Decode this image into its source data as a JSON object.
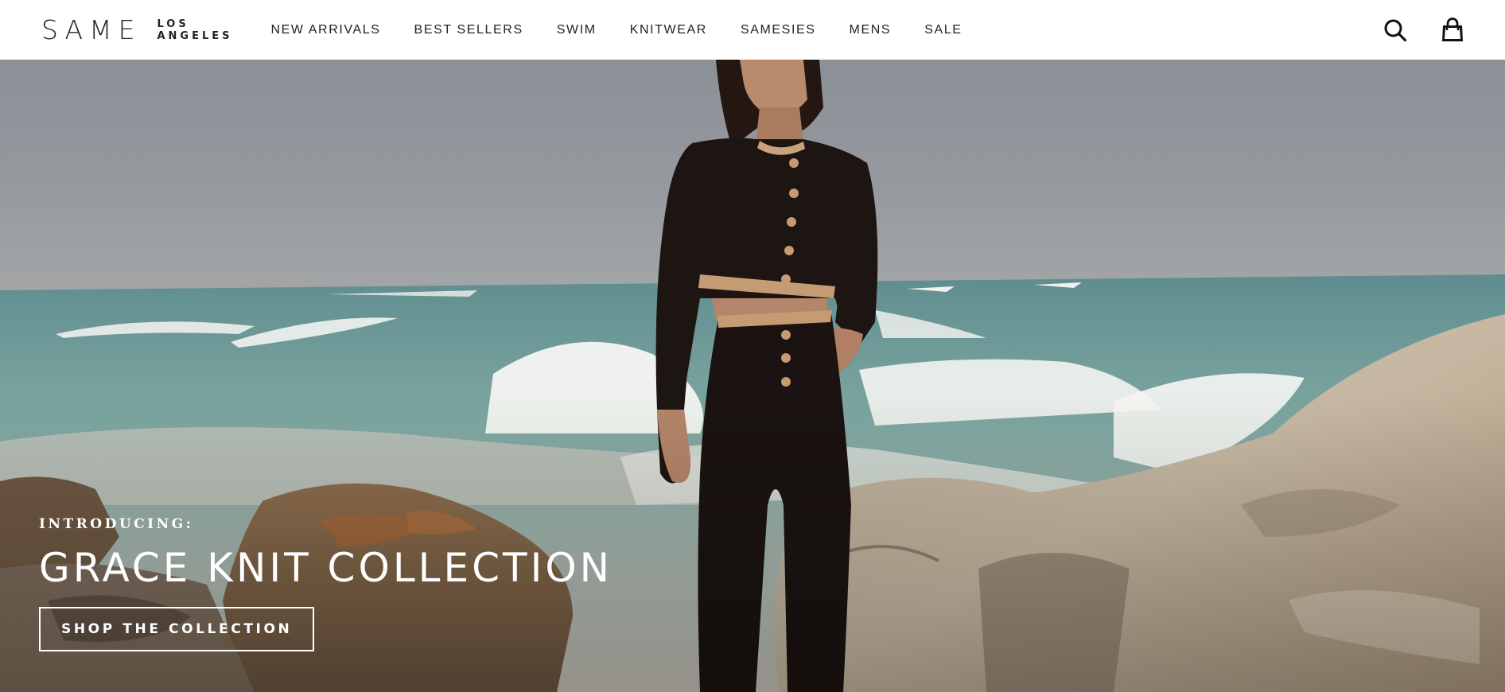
{
  "header": {
    "logo": {
      "wordmark": "SAME",
      "sub_line_1": "LOS",
      "sub_line_2": "ANGELES"
    },
    "nav": [
      {
        "label": "NEW ARRIVALS"
      },
      {
        "label": "BEST SELLERS"
      },
      {
        "label": "SWIM"
      },
      {
        "label": "KNITWEAR"
      },
      {
        "label": "SAMESIES"
      },
      {
        "label": "MENS"
      },
      {
        "label": "SALE"
      }
    ],
    "icons": {
      "search": "search-icon",
      "cart": "cart-icon"
    }
  },
  "hero": {
    "kicker": "INTRODUCING:",
    "title": "GRACE KNIT COLLECTION",
    "cta_label": "SHOP THE COLLECTION"
  },
  "colors": {
    "header_bg": "#ffffff",
    "text_dark": "#222222",
    "hero_text": "#ffffff",
    "sky": "#8e9298",
    "sea": "#6f9b99",
    "rock": "#b6a893",
    "outfit": "#1b1412",
    "trim": "#c79a72"
  }
}
